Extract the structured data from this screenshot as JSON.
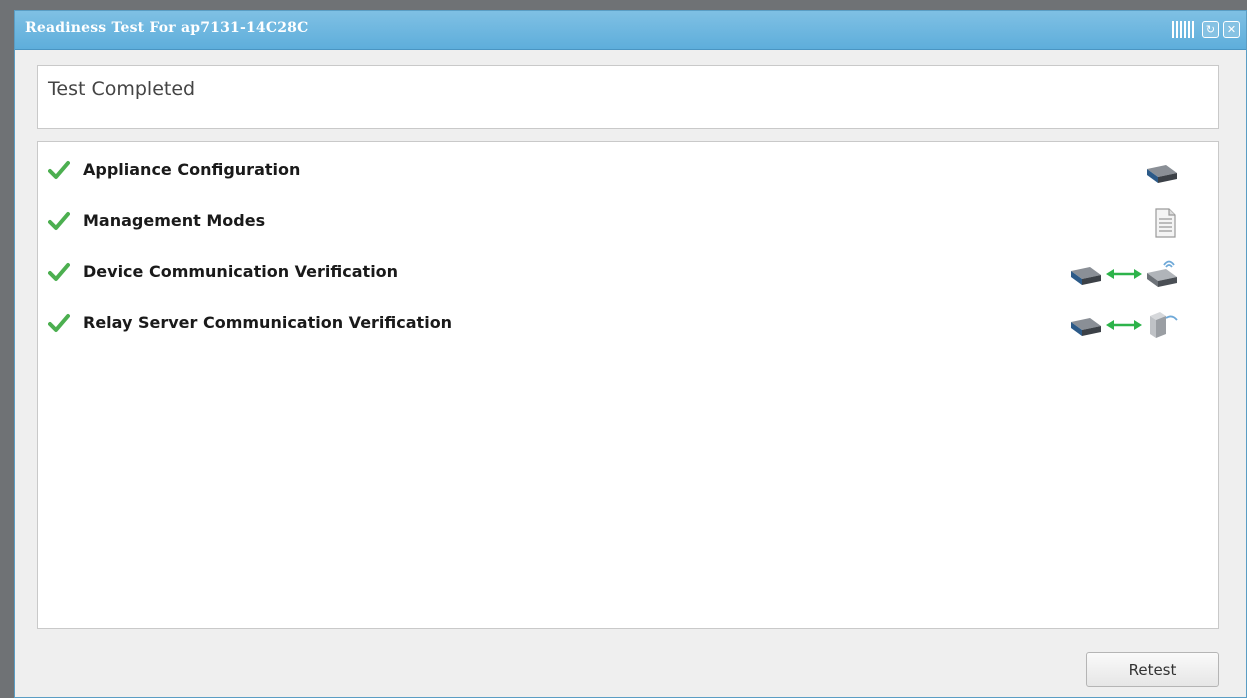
{
  "window": {
    "title": "Readiness Test For ap7131-14C28C"
  },
  "status": {
    "text": "Test Completed"
  },
  "tests": [
    {
      "label": "Appliance Configuration",
      "result": "passed",
      "icons": [
        "appliance-icon"
      ]
    },
    {
      "label": "Management Modes",
      "result": "passed",
      "icons": [
        "document-icon"
      ]
    },
    {
      "label": "Device Communication Verification",
      "result": "passed",
      "icons": [
        "appliance-icon",
        "bidirectional-arrow-icon",
        "wireless-ap-icon"
      ]
    },
    {
      "label": "Relay Server Communication Verification",
      "result": "passed",
      "icons": [
        "appliance-icon",
        "bidirectional-arrow-icon",
        "relay-server-icon"
      ]
    }
  ],
  "footer": {
    "retest_label": "Retest"
  },
  "colors": {
    "titlebar": "#6bb6df",
    "check": "#4caf50",
    "arrow": "#2db34a"
  }
}
